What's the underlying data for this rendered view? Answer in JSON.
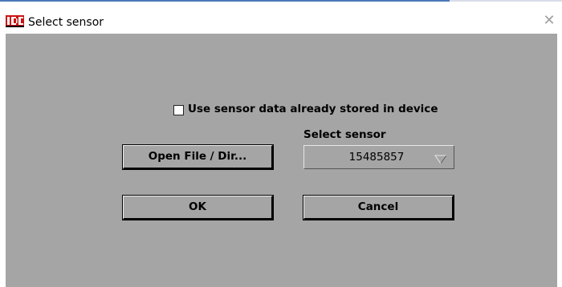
{
  "window": {
    "title": "Select sensor",
    "logo_text": "IDC"
  },
  "dialog": {
    "checkbox_label": "Use sensor data already stored in device",
    "checkbox_checked": false,
    "select_label": "Select sensor",
    "open_button": "Open File / Dir...",
    "sensor_value": "15485857",
    "ok_button": "OK",
    "cancel_button": "Cancel"
  },
  "colors": {
    "client_bg": "#a5a5a5",
    "logo_red": "#cc1111"
  }
}
